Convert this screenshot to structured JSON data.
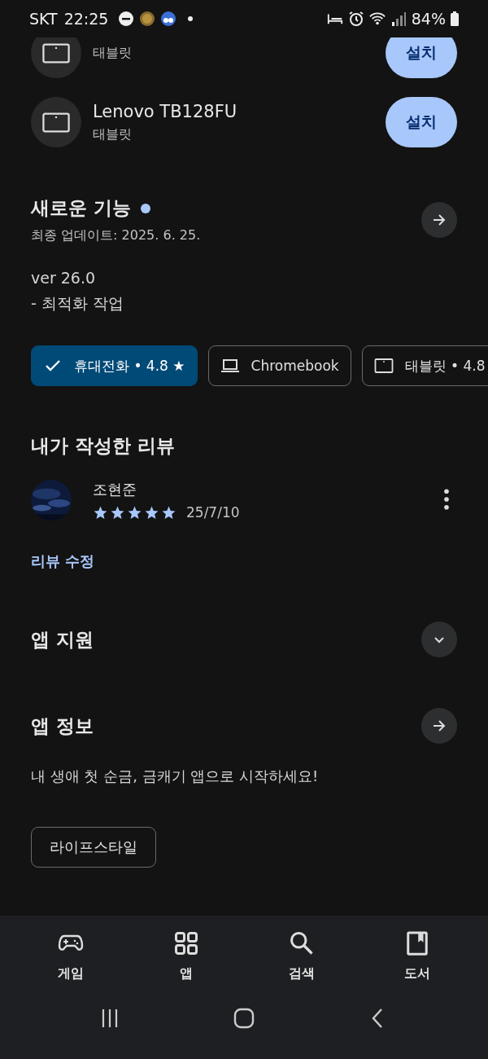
{
  "status_bar": {
    "carrier": "SKT",
    "time": "22:25",
    "battery": "84%"
  },
  "devices": [
    {
      "type": "태블릿",
      "action": "설치",
      "partial": true
    },
    {
      "name": "Lenovo TB128FU",
      "type": "태블릿",
      "action": "설치",
      "partial": false
    }
  ],
  "whats_new": {
    "title": "새로운 기능",
    "new_dot": true,
    "updated": "최종 업데이트: 2025. 6. 25.",
    "lines": [
      "ver 26.0",
      "- 최적화 작업"
    ]
  },
  "device_chips": [
    {
      "label": "휴대전화 • 4.8 ★",
      "selected": true
    },
    {
      "kind": "laptop",
      "label": "Chromebook",
      "selected": false
    },
    {
      "kind": "tablet",
      "label": "태블릿 • 4.8",
      "selected": false
    }
  ],
  "my_review": {
    "title": "내가 작성한 리뷰",
    "author": "조현준",
    "stars": 5,
    "date": "25/7/10",
    "edit_link": "리뷰 수정"
  },
  "app_support": {
    "title": "앱 지원",
    "expanded": false
  },
  "app_info": {
    "title": "앱 정보",
    "description": "내 생애 첫 순금, 금캐기 앱으로 시작하세요!",
    "tags": [
      "라이프스타일"
    ]
  },
  "bottom_nav": [
    {
      "kind": "games",
      "label": "게임"
    },
    {
      "kind": "apps",
      "label": "앱"
    },
    {
      "kind": "search",
      "label": "검색"
    },
    {
      "kind": "books",
      "label": "도서"
    }
  ]
}
